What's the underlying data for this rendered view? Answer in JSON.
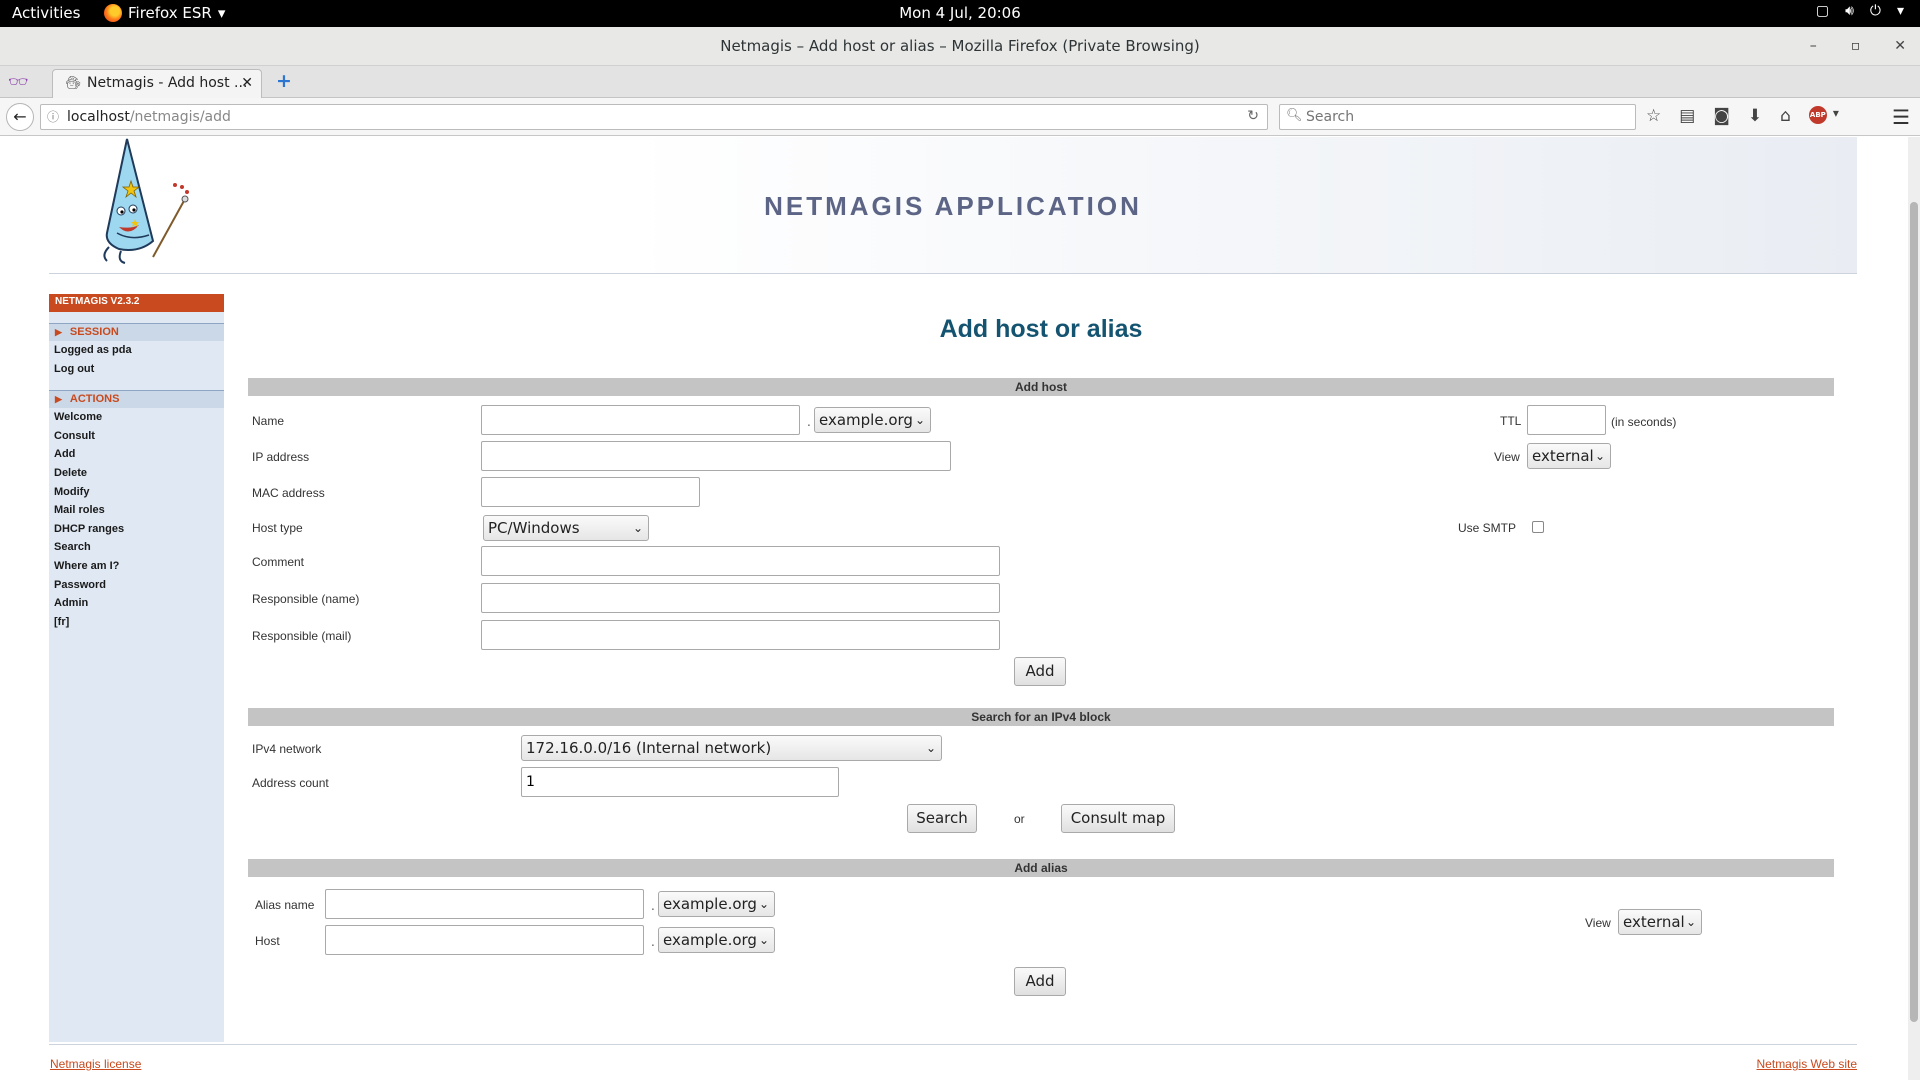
{
  "desktop": {
    "activities": "Activities",
    "app_menu": "Firefox ESR",
    "clock": "Mon  4 Jul, 20:06"
  },
  "window": {
    "title": "Netmagis – Add host or alias – Mozilla Firefox (Private Browsing)"
  },
  "browser": {
    "tab_title": "Netmagis - Add host ...",
    "url_host": "localhost",
    "url_path": "/netmagis/add",
    "search_placeholder": "Search"
  },
  "header": {
    "app_name": "NETMAGIS APPLICATION"
  },
  "sidebar": {
    "version": "NETMAGIS V2.3.2",
    "session_title": "SESSION",
    "session_items": [
      "Logged as pda",
      "Log out"
    ],
    "actions_title": "ACTIONS",
    "actions_items": [
      "Welcome",
      "Consult",
      "Add",
      "Delete",
      "Modify",
      "Mail roles",
      "DHCP ranges",
      "Search",
      "Where am I?",
      "Password",
      "Admin",
      "[fr]"
    ]
  },
  "page": {
    "title": "Add host or alias"
  },
  "add_host": {
    "section_title": "Add host",
    "name_label": "Name",
    "name_value": "",
    "domain": "example.org",
    "ip_label": "IP address",
    "ip_value": "",
    "mac_label": "MAC address",
    "mac_value": "",
    "hosttype_label": "Host type",
    "hosttype": "PC/Windows",
    "comment_label": "Comment",
    "comment_value": "",
    "resp_name_label": "Responsible (name)",
    "resp_name_value": "",
    "resp_mail_label": "Responsible (mail)",
    "resp_mail_value": "",
    "ttl_label": "TTL",
    "ttl_value": "",
    "ttl_hint": "(in seconds)",
    "view_label": "View",
    "view": "external",
    "smtp_label": "Use SMTP",
    "smtp_checked": false,
    "submit": "Add"
  },
  "search_block": {
    "section_title": "Search for an IPv4 block",
    "network_label": "IPv4 network",
    "network": "172.16.0.0/16 (Internal network)",
    "count_label": "Address count",
    "count_value": "1",
    "search_button": "Search",
    "or_text": "or",
    "map_button": "Consult map"
  },
  "add_alias": {
    "section_title": "Add alias",
    "alias_label": "Alias name",
    "alias_value": "",
    "alias_domain": "example.org",
    "host_label": "Host",
    "host_value": "",
    "host_domain": "example.org",
    "view_label": "View",
    "view": "external",
    "submit": "Add"
  },
  "footer": {
    "license": "Netmagis license",
    "website": "Netmagis Web site"
  }
}
